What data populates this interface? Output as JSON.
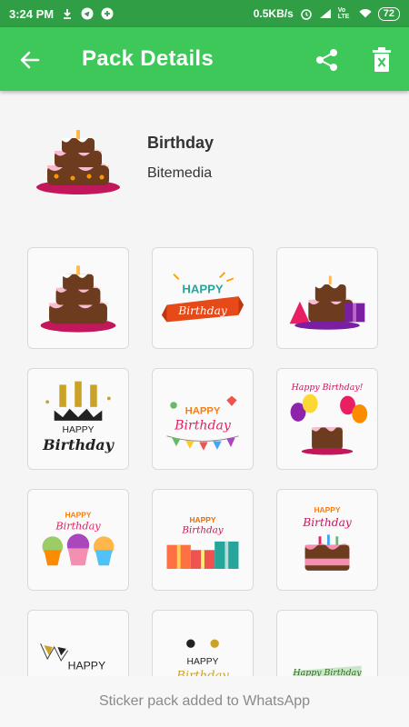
{
  "status_bar": {
    "time": "3:24 PM",
    "net_speed": "0.5KB/s",
    "volte": "Vo LTE",
    "battery": "72",
    "icons": [
      "download-icon",
      "telegram-icon",
      "add-circle-icon",
      "alarm-icon",
      "signal-icon",
      "wifi-icon",
      "battery-icon"
    ]
  },
  "app_bar": {
    "title": "Pack Details",
    "back_icon": "arrow-left-icon",
    "share_icon": "share-icon",
    "delete_icon": "delete-icon"
  },
  "pack": {
    "name": "Birthday",
    "publisher": "Bitemedia",
    "tray_icon": "birthday-cake-icon"
  },
  "stickers": [
    {
      "name": "sticker-cake",
      "text": ""
    },
    {
      "name": "sticker-happy-birthday-ribbon",
      "text": "HAPPY Birthday"
    },
    {
      "name": "sticker-cake-with-gift",
      "text": ""
    },
    {
      "name": "sticker-gold-candles",
      "text": "HAPPY Birthday"
    },
    {
      "name": "sticker-bunting-happy-birthday",
      "text": "HAPPY Birthday"
    },
    {
      "name": "sticker-balloons-cake",
      "text": "Happy Birthday!"
    },
    {
      "name": "sticker-cupcakes",
      "text": "HAPPY Birthday"
    },
    {
      "name": "sticker-gifts",
      "text": "HAPPY Birthday"
    },
    {
      "name": "sticker-pink-cake",
      "text": "HAPPY Birthday"
    },
    {
      "name": "sticker-gold-bunting",
      "text": "HAPPY Birthday"
    },
    {
      "name": "sticker-gold-confetti",
      "text": "HAPPY Birthday"
    },
    {
      "name": "sticker-green-ribbon",
      "text": "Happy Birthday"
    }
  ],
  "toast": "Sticker pack added to WhatsApp",
  "colors": {
    "status_bar": "#2f9e44",
    "app_bar": "#3ec85a",
    "background": "#f5f5f5"
  }
}
